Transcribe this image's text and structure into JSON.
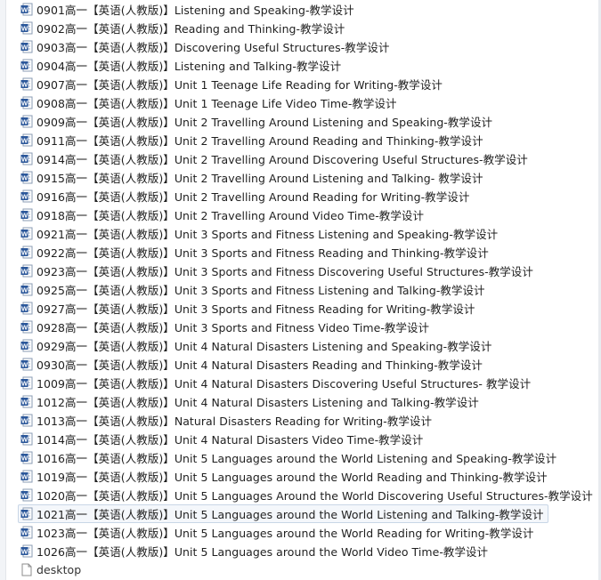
{
  "files": [
    {
      "name": "0901高一【英语(人教版)】Listening and Speaking-教学设计",
      "icon": "word-doc-icon"
    },
    {
      "name": "0902高一【英语(人教版)】Reading and Thinking-教学设计",
      "icon": "word-doc-icon"
    },
    {
      "name": "0903高一【英语(人教版)】Discovering Useful Structures-教学设计",
      "icon": "word-doc-icon"
    },
    {
      "name": "0904高一【英语(人教版)】Listening and Talking-教学设计",
      "icon": "word-doc-icon"
    },
    {
      "name": "0907高一【英语(人教版)】Unit 1 Teenage Life Reading for Writing-教学设计",
      "icon": "word-doc-icon"
    },
    {
      "name": "0908高一【英语(人教版)】Unit 1 Teenage Life Video Time-教学设计",
      "icon": "word-doc-icon"
    },
    {
      "name": "0909高一【英语(人教版)】Unit 2 Travelling Around Listening and Speaking-教学设计",
      "icon": "word-doc-icon"
    },
    {
      "name": "0911高一【英语(人教版)】Unit 2 Travelling Around Reading and Thinking-教学设计",
      "icon": "word-doc-icon"
    },
    {
      "name": "0914高一【英语(人教版)】Unit 2 Travelling Around  Discovering Useful Structures-教学设计",
      "icon": "word-doc-icon"
    },
    {
      "name": "0915高一【英语(人教版)】Unit 2 Travelling Around Listening and Talking- 教学设计",
      "icon": "word-doc-icon"
    },
    {
      "name": "0916高一【英语(人教版)】Unit 2 Travelling Around Reading for Writing-教学设计",
      "icon": "word-doc-icon"
    },
    {
      "name": "0918高一【英语(人教版)】Unit 2 Travelling Around Video Time-教学设计",
      "icon": "word-doc-icon"
    },
    {
      "name": "0921高一【英语(人教版)】Unit 3 Sports and Fitness Listening and Speaking-教学设计",
      "icon": "word-doc-icon"
    },
    {
      "name": "0922高一【英语(人教版)】Unit 3 Sports and Fitness Reading and Thinking-教学设计",
      "icon": "word-doc-icon"
    },
    {
      "name": "0923高一【英语(人教版)】Unit 3 Sports and Fitness Discovering Useful Structures-教学设计",
      "icon": "word-doc-icon"
    },
    {
      "name": "0925高一【英语(人教版)】Unit 3 Sports and Fitness Listening and Talking-教学设计",
      "icon": "word-doc-icon"
    },
    {
      "name": "0927高一【英语(人教版)】Unit 3 Sports and Fitness Reading for Writing-教学设计",
      "icon": "word-doc-icon"
    },
    {
      "name": "0928高一【英语(人教版)】Unit 3 Sports and Fitness Video Time-教学设计",
      "icon": "word-doc-icon"
    },
    {
      "name": "0929高一【英语(人教版)】Unit 4 Natural Disasters Listening and Speaking-教学设计",
      "icon": "word-doc-icon"
    },
    {
      "name": "0930高一【英语(人教版)】Unit 4 Natural Disasters Reading and Thinking-教学设计",
      "icon": "word-doc-icon"
    },
    {
      "name": "1009高一【英语(人教版)】Unit 4 Natural Disasters Discovering Useful Structures- 教学设计",
      "icon": "word-doc-icon"
    },
    {
      "name": "1012高一【英语(人教版)】Unit 4 Natural Disasters Listening and Talking-教学设计",
      "icon": "word-doc-icon"
    },
    {
      "name": "1013高一【英语(人教版)】Natural Disasters Reading for Writing-教学设计",
      "icon": "word-doc-icon"
    },
    {
      "name": "1014高一【英语(人教版)】Unit 4 Natural Disasters Video Time-教学设计",
      "icon": "word-doc-icon"
    },
    {
      "name": "1016高一【英语(人教版)】Unit 5 Languages around the World Listening and Speaking-教学设计",
      "icon": "word-doc-icon"
    },
    {
      "name": "1019高一【英语(人教版)】Unit 5 Languages around the World Reading and Thinking-教学设计",
      "icon": "word-doc-icon"
    },
    {
      "name": "1020高一【英语(人教版)】Unit 5 Languages Around the World Discovering Useful Structures-教学设计",
      "icon": "word-doc-icon"
    },
    {
      "name": "1021高一【英语(人教版)】Unit 5 Languages around the World Listening and Talking-教学设计",
      "icon": "word-doc-icon",
      "selected": true
    },
    {
      "name": "1023高一【英语(人教版)】Unit 5 Languages around the World Reading for Writing-教学设计",
      "icon": "word-doc-icon"
    },
    {
      "name": "1026高一【英语(人教版)】Unit 5 Languages around the World Video Time-教学设计",
      "icon": "word-doc-icon"
    }
  ],
  "partial_item": {
    "name": "desktop",
    "icon": "file-icon"
  },
  "colors": {
    "word_icon_blue": "#2b579a",
    "selection_border": "#c8d6e6",
    "selection_fill": "#f4f7fb"
  }
}
